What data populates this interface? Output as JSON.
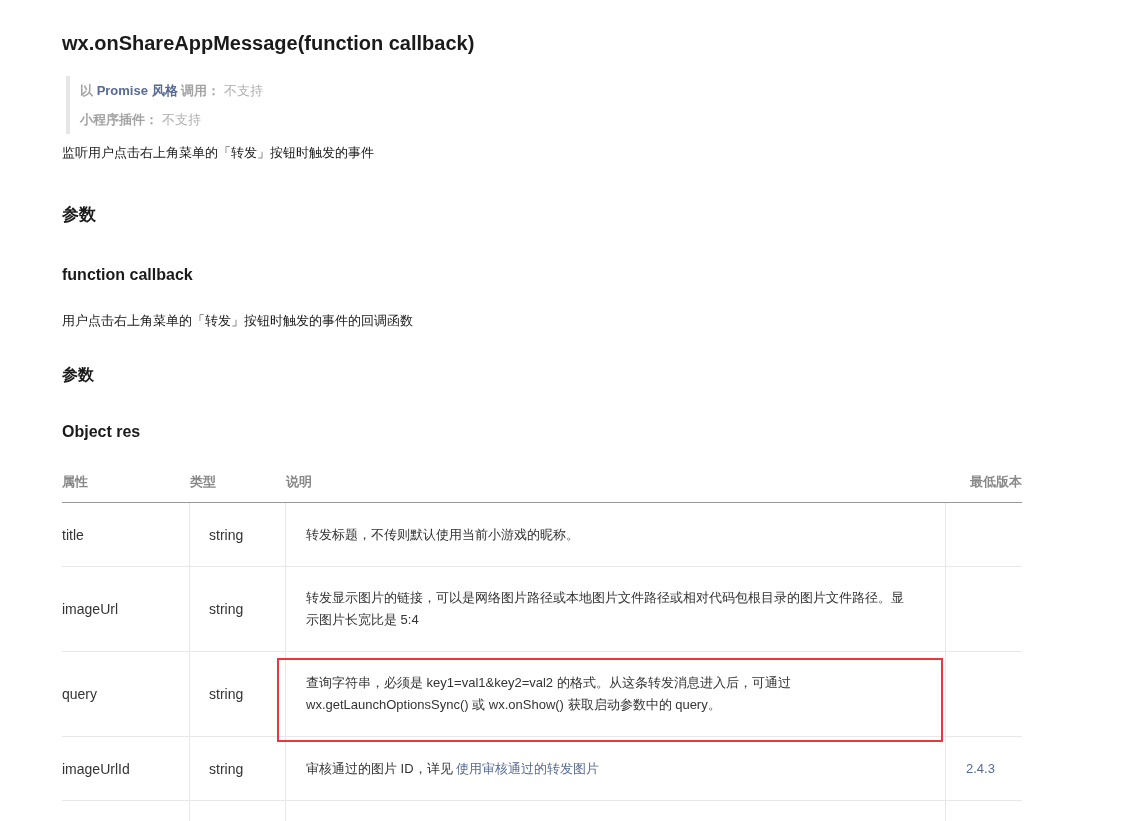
{
  "title": "wx.onShareAppMessage(function callback)",
  "notes": [
    {
      "parts": [
        {
          "text": "以 ",
          "kind": "plain"
        },
        {
          "text": "Promise 风格",
          "kind": "link"
        },
        {
          "text": " 调用：",
          "kind": "plain"
        }
      ],
      "value": "不支持"
    },
    {
      "parts": [
        {
          "text": "小程序插件：",
          "kind": "plain"
        }
      ],
      "value": "不支持"
    }
  ],
  "description": "监听用户点击右上角菜单的「转发」按钮时触发的事件",
  "params_heading": "参数",
  "callback_heading": "function callback",
  "callback_description": "用户点击右上角菜单的「转发」按钮时触发的事件的回调函数",
  "callback_params_heading": "参数",
  "object_heading": "Object res",
  "table": {
    "columns": [
      "属性",
      "类型",
      "说明",
      "最低版本"
    ],
    "rows": [
      {
        "name": "title",
        "type": "string",
        "description": [
          {
            "text": "转发标题，不传则默认使用当前小游戏的昵称。",
            "kind": "plain"
          }
        ],
        "highlighted": false
      },
      {
        "name": "imageUrl",
        "type": "string",
        "description": [
          {
            "text": "转发显示图片的链接，可以是网络图片路径或本地图片文件路径或相对代码包根目录的图片文件路径。显示图片长宽比是 5:4",
            "kind": "plain"
          }
        ],
        "highlighted": false
      },
      {
        "name": "query",
        "type": "string",
        "description": [
          {
            "text": "查询字符串，必须是 key1=val1&key2=val2 的格式。从这条转发消息进入后，可通过 wx.getLaunchOptionsSync() 或 wx.onShow() 获取启动参数中的 query。",
            "kind": "plain"
          }
        ],
        "highlighted": true
      },
      {
        "name": "imageUrlId",
        "type": "string",
        "description": [
          {
            "text": "审核通过的图片 ID，详见 ",
            "kind": "plain"
          },
          {
            "text": "使用审核通过的转发图片",
            "kind": "link"
          }
        ],
        "version": "2.4.3",
        "highlighted": false
      }
    ]
  }
}
